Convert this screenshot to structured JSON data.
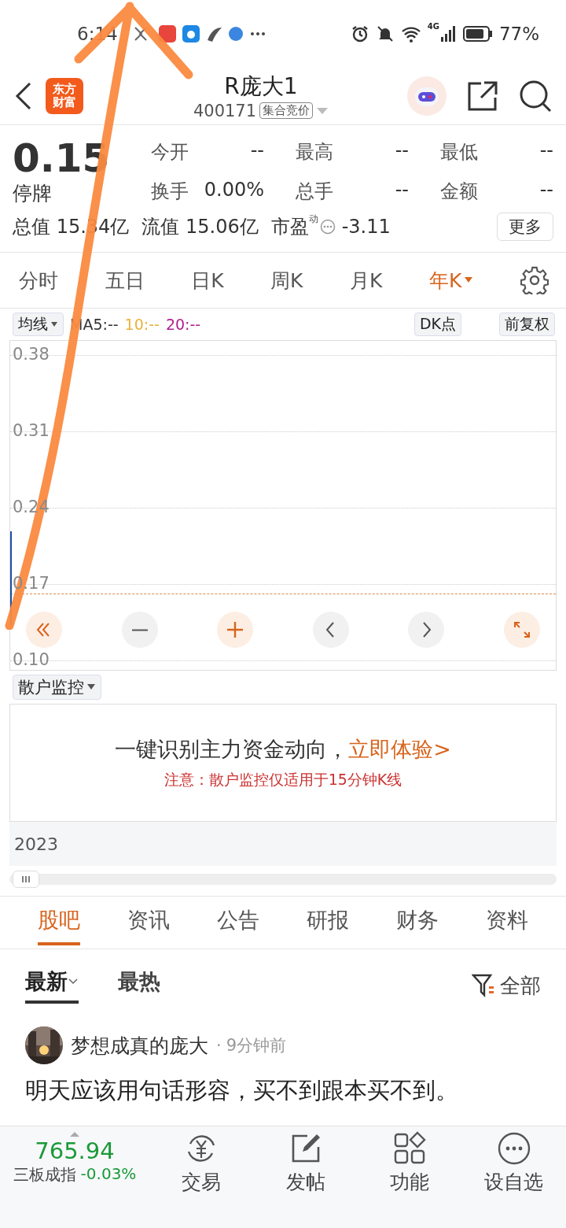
{
  "status_bar": {
    "time": "6:14",
    "battery": "77%",
    "network": "4G"
  },
  "header": {
    "logo": [
      "东方",
      "财富"
    ],
    "title": "R庞大1",
    "code": "400171",
    "badge": "集合竞价"
  },
  "quote": {
    "price": "0.15",
    "status": "停牌",
    "fields": [
      {
        "label": "今开",
        "value": "--"
      },
      {
        "label": "最高",
        "value": "--"
      },
      {
        "label": "最低",
        "value": "--"
      },
      {
        "label": "换手",
        "value": "0.00%"
      },
      {
        "label": "总手",
        "value": "--"
      },
      {
        "label": "金额",
        "value": "--"
      }
    ],
    "total_value": {
      "label": "总值",
      "value": "15.34亿"
    },
    "float_value": {
      "label": "流值",
      "value": "15.06亿"
    },
    "pe": {
      "label": "市盈",
      "sup": "动",
      "value": "-3.11"
    },
    "more": "更多"
  },
  "chart_tabs": [
    {
      "label": "分时",
      "selected": false
    },
    {
      "label": "五日",
      "selected": false
    },
    {
      "label": "日K",
      "selected": false
    },
    {
      "label": "周K",
      "selected": false
    },
    {
      "label": "月K",
      "selected": false
    },
    {
      "label": "年K",
      "selected": true
    }
  ],
  "indicator_bar": {
    "ma_select": "均线",
    "ma5": "MA5:--",
    "ma10": "10:--",
    "ma20": "20:--",
    "dk": "DK点",
    "adjust": "前复权"
  },
  "chart": {
    "yticks": [
      "0.38",
      "0.31",
      "0.24",
      "0.17",
      "0.10"
    ]
  },
  "chart_controls": [
    {
      "kind": "first",
      "accent": true
    },
    {
      "kind": "minus",
      "accent": false
    },
    {
      "kind": "plus",
      "accent": true
    },
    {
      "kind": "prev",
      "accent": false
    },
    {
      "kind": "next",
      "accent": false
    },
    {
      "kind": "expand",
      "accent": true
    }
  ],
  "monitor": {
    "select": "散户监控",
    "headline": "一键识别主力资金动向，",
    "link": "立即体验>",
    "note": "注意：散户监控仅适用于15分钟K线"
  },
  "timeline": {
    "year": "2023"
  },
  "section_tabs": [
    {
      "label": "股吧",
      "selected": true
    },
    {
      "label": "资讯",
      "selected": false
    },
    {
      "label": "公告",
      "selected": false
    },
    {
      "label": "研报",
      "selected": false
    },
    {
      "label": "财务",
      "selected": false
    },
    {
      "label": "资料",
      "selected": false
    }
  ],
  "sort_tabs": [
    {
      "label": "最新",
      "selected": true
    },
    {
      "label": "最热",
      "selected": false
    }
  ],
  "filter": "全部",
  "post": {
    "author": "梦想成真的庞大",
    "separator": "·",
    "time": "9分钟前",
    "text": "明天应该用句话形容，买不到跟本买不到。"
  },
  "bottom_bar": {
    "index_value": "765.94",
    "index_name": "三板成指",
    "index_change": "-0.03%",
    "items": [
      {
        "kind": "trade",
        "label": "交易"
      },
      {
        "kind": "post",
        "label": "发帖"
      },
      {
        "kind": "apps",
        "label": "功能"
      },
      {
        "kind": "watch",
        "label": "设自选"
      }
    ]
  }
}
